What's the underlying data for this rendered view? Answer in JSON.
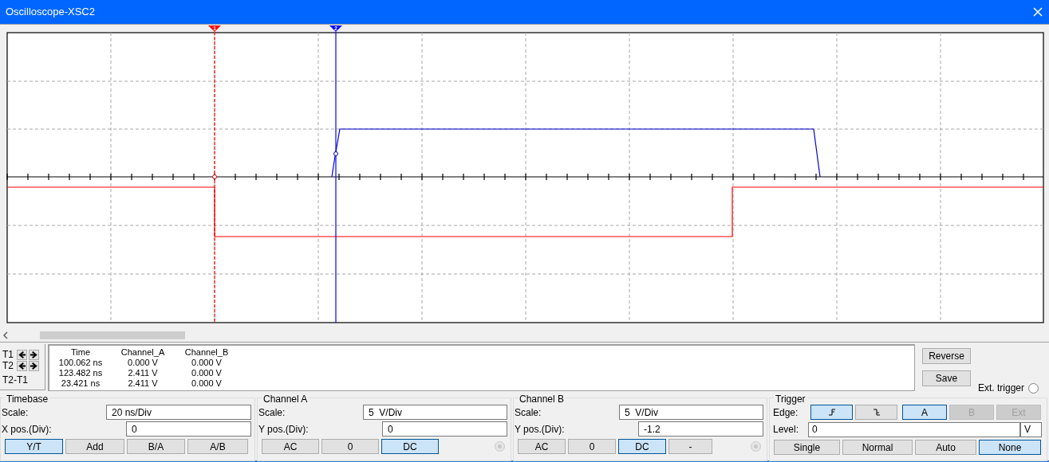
{
  "window": {
    "title": "Oscilloscope-XSC2"
  },
  "display": {
    "cursors": [
      {
        "label": "1"
      },
      {
        "label": "2"
      }
    ]
  },
  "cursor_panel": {
    "labels": [
      "T1",
      "T2",
      "T2-T1"
    ],
    "columns": [
      "Time",
      "Channel_A",
      "Channel_B"
    ],
    "rows": [
      [
        "100.062 ns",
        "0.000 V",
        "0.000 V"
      ],
      [
        "123.482 ns",
        "2.411 V",
        "0.000 V"
      ],
      [
        "23.421 ns",
        "2.411 V",
        "0.000 V"
      ]
    ],
    "buttons": [
      "Reverse",
      "Save"
    ],
    "ext_trigger": {
      "label": "Ext. trigger",
      "checked": false
    }
  },
  "timebase": {
    "title": "Timebase",
    "fields": [
      {
        "label": "Scale:",
        "value": "20 ns/Div"
      },
      {
        "label": "X pos.(Div):",
        "value": "0"
      }
    ],
    "modes": [
      {
        "label": "Y/T",
        "selected": true
      },
      {
        "label": "Add",
        "selected": false
      },
      {
        "label": "B/A",
        "selected": false
      },
      {
        "label": "A/B",
        "selected": false
      }
    ]
  },
  "channels": [
    {
      "title": "Channel A",
      "fields": [
        {
          "label": "Scale:",
          "value": "5  V/Div"
        },
        {
          "label": "Y pos.(Div):",
          "value": "0"
        }
      ],
      "coupling": [
        {
          "label": "AC",
          "selected": false
        },
        {
          "label": "0",
          "selected": false
        },
        {
          "label": "DC",
          "selected": true
        }
      ],
      "radio_disabled": true
    },
    {
      "title": "Channel B",
      "fields": [
        {
          "label": "Scale:",
          "value": "5  V/Div"
        },
        {
          "label": "Y pos.(Div):",
          "value": "-1.2"
        }
      ],
      "coupling": [
        {
          "label": "AC",
          "selected": false
        },
        {
          "label": "0",
          "selected": false
        },
        {
          "label": "DC",
          "selected": true
        },
        {
          "label": "-",
          "selected": false
        }
      ],
      "radio_disabled": true
    }
  ],
  "trigger": {
    "title": "Trigger",
    "edge_label": "Edge:",
    "edges": [
      {
        "kind": "rising",
        "selected": true
      },
      {
        "kind": "falling",
        "selected": false
      }
    ],
    "sources": [
      {
        "label": "A",
        "selected": true,
        "disabled": false
      },
      {
        "label": "B",
        "selected": false,
        "disabled": true
      },
      {
        "label": "Ext",
        "selected": false,
        "disabled": true
      }
    ],
    "level_label": "Level:",
    "level_value": "0",
    "level_unit": "V",
    "modes": [
      {
        "label": "Single",
        "selected": false
      },
      {
        "label": "Normal",
        "selected": false
      },
      {
        "label": "Auto",
        "selected": false
      },
      {
        "label": "None",
        "selected": true
      }
    ]
  }
}
